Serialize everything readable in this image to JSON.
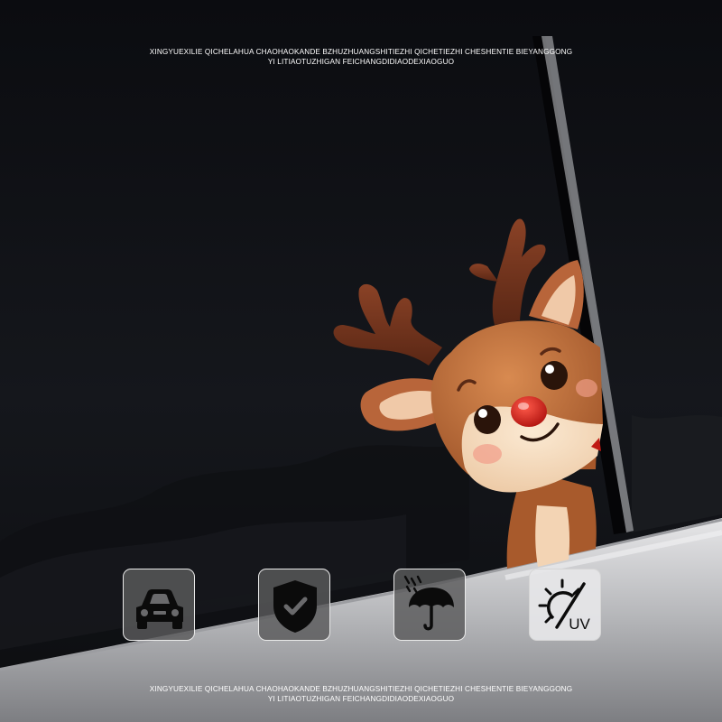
{
  "captions": {
    "top": [
      "XINGYUEXILIE QICHELAHUA CHAOHAOKANDE BZHUZHUANGSHITIEZHI QICHETIEZHI CHESHENTIE BIEYANGGONG",
      "YI LITIAOTUZHIGAN FEICHANGDIDIAODEXIAOGUO"
    ],
    "bottom": [
      "XINGYUEXILIE QICHELAHUA CHAOHAOKANDE BZHUZHUANGSHITIEZHI QICHETIEZHI CHESHENTIE BIEYANGGONG",
      "YI LITIAOTUZHIGAN FEICHANGDIDIAODEXIAOGUO"
    ]
  },
  "feature_icons": [
    {
      "icon": "car-icon"
    },
    {
      "icon": "shield-check-icon"
    },
    {
      "icon": "umbrella-rain-icon"
    },
    {
      "icon": "uv-sun-icon",
      "label": "UV"
    }
  ],
  "colors": {
    "glass": "#121318",
    "car_body": "#cfd0d3",
    "antler": "#6e321c",
    "fur": "#c0703c",
    "muzzle": "#f6ddc0",
    "nose": "#d7261e"
  }
}
